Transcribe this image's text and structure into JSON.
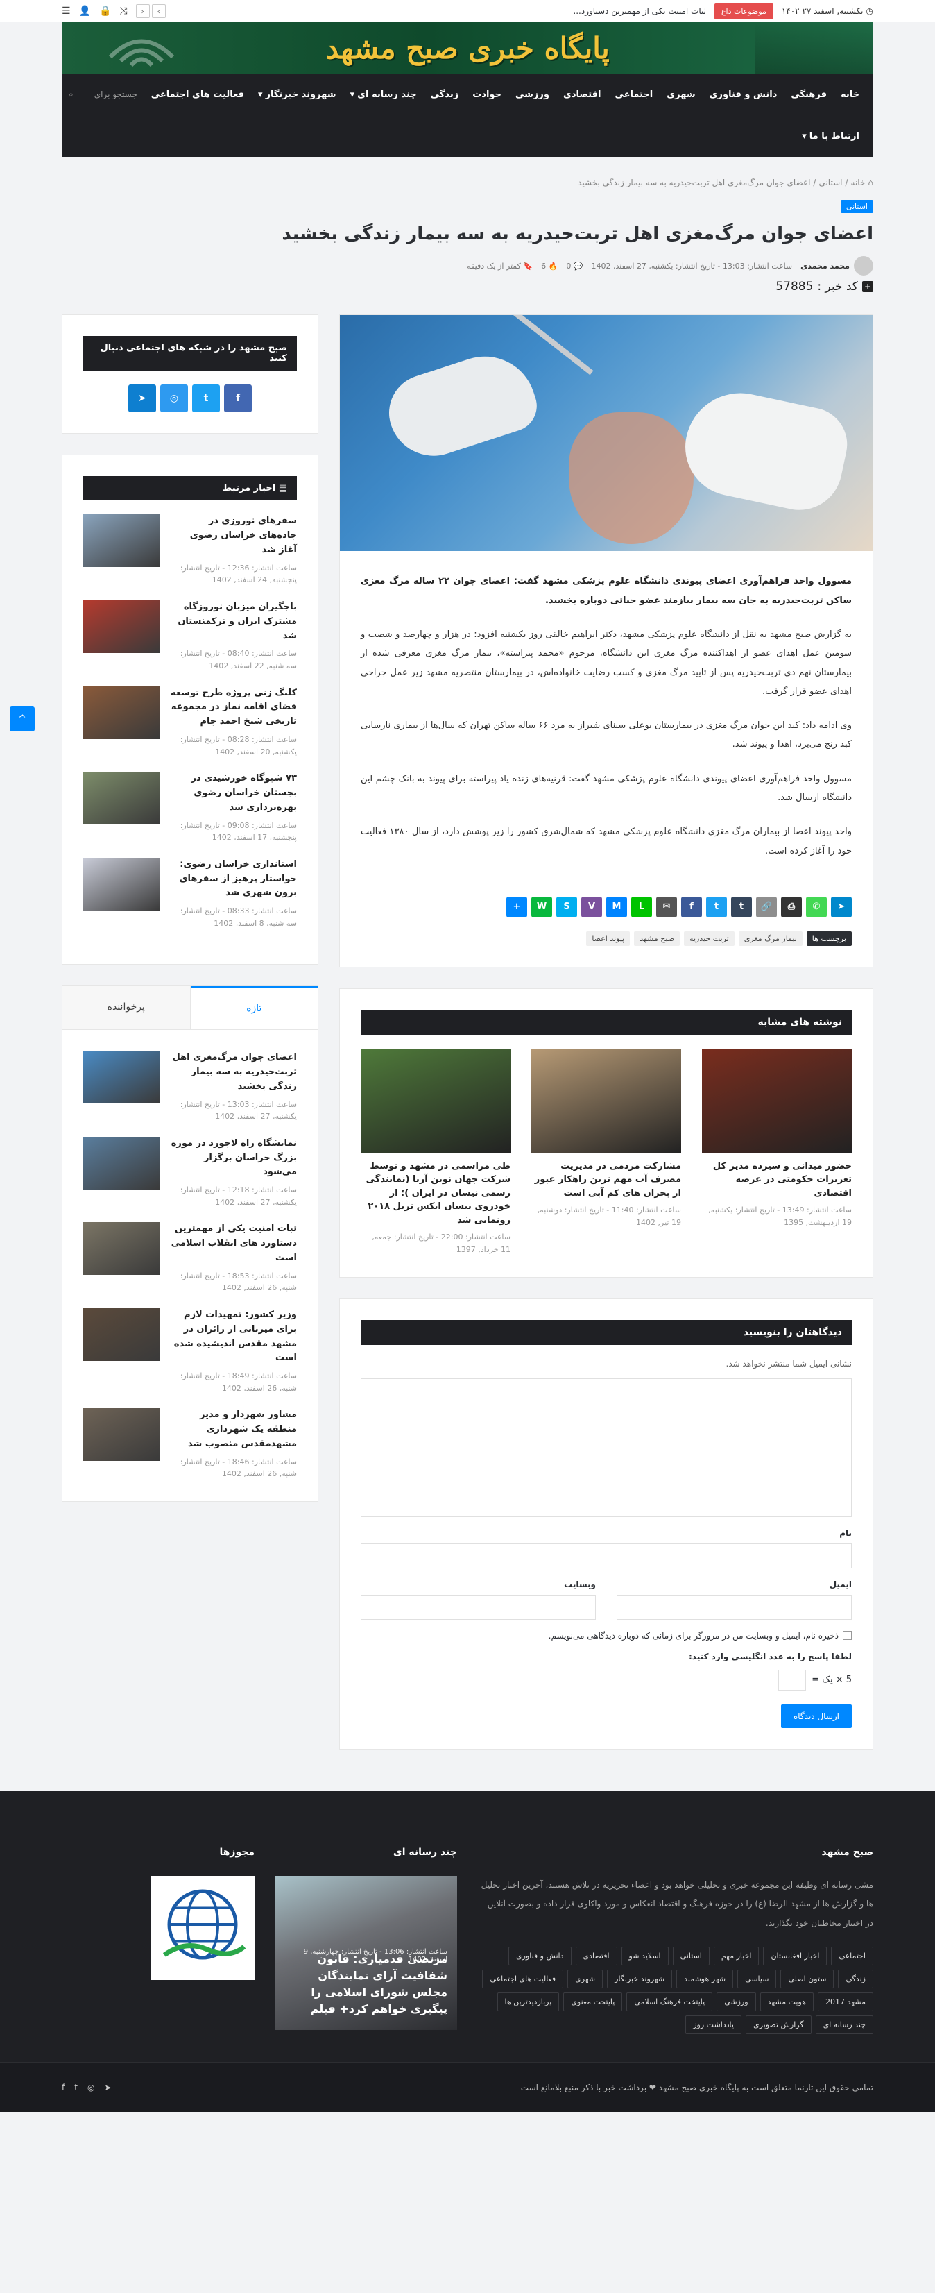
{
  "topbar": {
    "date": "یکشنبه, اسفند ۲۷ ۱۴۰۲",
    "hot_label": "موضوعات داغ",
    "ticker": "ثبات امنیت یکی از مهمترین دستاورد..."
  },
  "banner": {
    "title": "پایگاه خبری صبح مشهد",
    "logo_text": "صبح"
  },
  "nav": {
    "items": [
      {
        "label": "خانه",
        "has_dropdown": false
      },
      {
        "label": "فرهنگی",
        "has_dropdown": false
      },
      {
        "label": "دانش و فناوری",
        "has_dropdown": false
      },
      {
        "label": "شهری",
        "has_dropdown": false
      },
      {
        "label": "اجتماعی",
        "has_dropdown": false
      },
      {
        "label": "اقتصادی",
        "has_dropdown": false
      },
      {
        "label": "ورزشی",
        "has_dropdown": false
      },
      {
        "label": "حوادث",
        "has_dropdown": false
      },
      {
        "label": "زندگی",
        "has_dropdown": false
      },
      {
        "label": "چند رسانه ای",
        "has_dropdown": true
      },
      {
        "label": "شهروند خبرنگار",
        "has_dropdown": true
      },
      {
        "label": "فعالیت های اجتماعی",
        "has_dropdown": false
      }
    ],
    "row2": {
      "label": "ارتباط با ما",
      "has_dropdown": true
    },
    "search_placeholder": "جستجو برای"
  },
  "breadcrumb": {
    "home": "خانه",
    "sep": "/",
    "cat": "استانی",
    "current": "اعضای جوان مرگ‌مغزی اهل تربت‌حیدریه به سه بیمار زندگی بخشید"
  },
  "post": {
    "category": "استانی",
    "title": "اعضای جوان مرگ‌مغزی اهل تربت‌حیدریه به سه بیمار زندگی بخشید",
    "author": "محمد محمدی",
    "meta_time": "ساعت انتشار: 13:03 - تاریخ انتشار: یکشنبه, 27 اسفند, 1402",
    "comments": "0",
    "views": "6",
    "read_time": "کمتر از یک دقیقه",
    "news_code_label": "کد خبر :",
    "news_code": "57885",
    "paragraphs": [
      "مسوول واحد فراهم‌آوری اعضای پیوندی دانشگاه علوم پزشکی مشهد گفت: اعضای جوان ۲۲ ساله مرگ مغزی ساکن تربت‌حیدریه به جان سه بیمار نیازمند عضو حیاتی دوباره بخشید.",
      "به گزارش صبح مشهد به نقل از دانشگاه علوم پزشکی مشهد، دکتر ابراهیم خالقی روز یکشنبه افزود: در هزار و چهارصد و شصت و سومین عمل اهدای عضو از اهداکننده مرگ مغزی این دانشگاه، مرحوم «محمد پیراسته»، بیمار مرگ مغزی معرفی شده از بیمارستان نهم دی تربت‌حیدریه پس از تایید مرگ مغزی و کسب رضایت خانواده‌اش، در بیمارستان منتصریه مشهد زیر عمل جراحی اهدای عضو قرار گرفت.",
      "وی ادامه داد: کبد این جوان مرگ مغزی در بیمارستان بوعلی سینای شیراز به مرد ۶۶ ساله ساکن تهران که سال‌ها از بیماری نارسایی کبد رنج می‌برد، اهدا و پیوند شد.",
      "مسوول واحد فراهم‌آوری اعضای پیوندی دانشگاه علوم پزشکی مشهد گفت: قرنیه‌های زنده یاد پیراسته برای پیوند به بانک چشم این دانشگاه ارسال شد.",
      "واحد پیوند اعضا از بیماران مرگ مغزی دانشگاه علوم پزشکی مشهد که شمال‌شرق کشور را زیر پوشش دارد، از سال ۱۳۸۰ فعالیت خود را آغاز کرده است."
    ],
    "tags_label": "برچسب ها",
    "tags": [
      "بیمار مرگ مغزی",
      "تربت حیدریه",
      "صبح مشهد",
      "پیوند اعضا"
    ]
  },
  "share": [
    {
      "icon": "telegram-icon",
      "glyph": "➤",
      "color": "#08c"
    },
    {
      "icon": "whatsapp-icon",
      "glyph": "✆",
      "color": "#43d854"
    },
    {
      "icon": "print-icon",
      "glyph": "⎙",
      "color": "#333"
    },
    {
      "icon": "link-icon",
      "glyph": "🔗",
      "color": "#8e8e8e"
    },
    {
      "icon": "tumblr-icon",
      "glyph": "t",
      "color": "#35465c"
    },
    {
      "icon": "twitter-icon",
      "glyph": "t",
      "color": "#1da1f2"
    },
    {
      "icon": "facebook-icon",
      "glyph": "f",
      "color": "#3b5998"
    },
    {
      "icon": "email-icon",
      "glyph": "✉",
      "color": "#555"
    },
    {
      "icon": "line-icon",
      "glyph": "L",
      "color": "#00c300"
    },
    {
      "icon": "messenger-icon",
      "glyph": "M",
      "color": "#0084ff"
    },
    {
      "icon": "viber-icon",
      "glyph": "V",
      "color": "#7b519d"
    },
    {
      "icon": "skype-icon",
      "glyph": "S",
      "color": "#00aff0"
    },
    {
      "icon": "wechat-icon",
      "glyph": "W",
      "color": "#09b83e"
    },
    {
      "icon": "share-plus-icon",
      "glyph": "+",
      "color": "#0088ff"
    }
  ],
  "related": {
    "title": "نوشته های مشابه",
    "items": [
      {
        "title": "حضور میدانی و سیزده مدیر کل تعزیرات حکومتی در عرصه اقتصادی",
        "meta": "ساعت انتشار: 13:49 - تاریخ انتشار: یکشنبه, 19 اردیبهشت, 1395",
        "color": "#7a2d1e"
      },
      {
        "title": "مشارکت مردمی در مدیریت مصرف آب مهم ترین راهکار عبور از بحران های کم آبی است",
        "meta": "ساعت انتشار: 11:40 - تاریخ انتشار: دوشنبه, 19 تیر, 1402",
        "color": "#b79a75"
      },
      {
        "title": "طی مراسمی در مشهد و توسط شرکت جهان نوین آریا (نمایندگی رسمی نیسان در ایران )؛ از خودروی نیسان ایکس تریل ۲۰۱۸ رونمایی شد",
        "meta": "ساعت انتشار: 22:00 - تاریخ انتشار: جمعه, 11 خرداد, 1397",
        "color": "#4f7a3a"
      }
    ]
  },
  "comments_form": {
    "title": "دیدگاهتان را بنویسید",
    "note": "نشانی ایمیل شما منتشر نخواهد شد.",
    "name_label": "نام",
    "email_label": "ایمیل",
    "website_label": "وبسایت",
    "save_label": "ذخیره نام، ایمیل و وبسایت من در مرورگر برای زمانی که دوباره دیدگاهی می‌نویسم.",
    "captcha_label": "لطفا پاسخ را به عدد انگلیسی وارد کنید:",
    "captcha_question": "5 × یک =",
    "submit_label": "ارسال دیدگاه"
  },
  "sidebar": {
    "social_title": "صبح مشهد را در شبکه های اجتماعی دنبال کنید",
    "social": [
      {
        "icon": "facebook-icon",
        "glyph": "f",
        "color": "#4267b2"
      },
      {
        "icon": "twitter-icon",
        "glyph": "t",
        "color": "#1da1f2"
      },
      {
        "icon": "instagram-icon",
        "glyph": "◎",
        "color": "#2e9af0"
      },
      {
        "icon": "telegram-icon",
        "glyph": "➤",
        "color": "#0e7fd0"
      }
    ],
    "related_title": "اخبار مرتبط",
    "related_posts": [
      {
        "title": "سفرهای نوروزی در جاده‌های خراسان رضوی آغاز شد",
        "meta": "ساعت انتشار: 12:36 - تاریخ انتشار: پنجشنبه, 24 اسفند, 1402",
        "color": "#8aa4bd"
      },
      {
        "title": "باجگیران میزبان نوروزگاه مشترک ایران و ترکمنستان شد",
        "meta": "ساعت انتشار: 08:40 - تاریخ انتشار: سه شنبه, 22 اسفند, 1402",
        "color": "#b53a2e"
      },
      {
        "title": "کلنگ زنی پروژه طرح توسعه فضای اقامه نماز در مجموعه تاریخی شیخ احمد جام",
        "meta": "ساعت انتشار: 08:28 - تاریخ انتشار: یکشنبه, 20 اسفند, 1402",
        "color": "#8a5a3a"
      },
      {
        "title": "۷۳ شبوگاه خورشیدی در بجستان خراسان رضوی بهره‌برداری شد",
        "meta": "ساعت انتشار: 09:08 - تاریخ انتشار: پنجشنبه, 17 اسفند, 1402",
        "color": "#7d8d6a"
      },
      {
        "title": "استانداری خراسان رضوی: خواستار پرهیز از سفرهای برون شهری شد",
        "meta": "ساعت انتشار: 08:33 - تاریخ انتشار: سه شنبه, 8 اسفند, 1402",
        "color": "#c9ccd8"
      }
    ],
    "tab_latest": "تازه",
    "tab_popular": "پرخواننده",
    "latest_posts": [
      {
        "title": "اعضای جوان مرگ‌مغزی اهل تربت‌حیدریه به سه بیمار زندگی بخشید",
        "meta": "ساعت انتشار: 13:03 - تاریخ انتشار: یکشنبه, 27 اسفند, 1402",
        "color": "#4a8bc4"
      },
      {
        "title": "نمایشگاه راه لاجورد در موزه بزرگ خراسان برگزار می‌شود",
        "meta": "ساعت انتشار: 12:18 - تاریخ انتشار: یکشنبه, 27 اسفند, 1402",
        "color": "#5a7e9e"
      },
      {
        "title": "ثبات امنیت یکی از مهمترین دستاورد های انقلاب اسلامی است",
        "meta": "ساعت انتشار: 18:53 - تاریخ انتشار: شنبه, 26 اسفند, 1402",
        "color": "#7b7565"
      },
      {
        "title": "وزیر کشور: تمهیدات لازم برای میزبانی از زائران در مشهد مقدس اندیشیده شده است",
        "meta": "ساعت انتشار: 18:49 - تاریخ انتشار: شنبه, 26 اسفند, 1402",
        "color": "#5b4a3b"
      },
      {
        "title": "مشاور شهردار و مدیر منطقه یک شهرداری مشهدمقدس منصوب شد",
        "meta": "ساعت انتشار: 18:46 - تاریخ انتشار: شنبه, 26 اسفند, 1402",
        "color": "#6e6356"
      }
    ]
  },
  "footer": {
    "about_title": "صبح مشهد",
    "about_text": "مشی رسانه ای وظیفه این مجموعه خبری و تحلیلی خواهد بود و اعضاء تحریریه در تلاش هستند، آخرین اخبار تحلیل ها و گزارش ها از مشهد الرضا (ع) را در حوزه فرهنگ و اقتصاد انعکاس و مورد واکاوی قرار داده و بصورت آنلاین در اختیار مخاطبان خود بگذارند.",
    "tags": [
      "اجتماعی",
      "اخبار افغانستان",
      "اخبار مهم",
      "استانی",
      "اسلاید شو",
      "اقتصادی",
      "دانش و فناوری",
      "زندگی",
      "ستون اصلی",
      "سیاسی",
      "شهر هوشمند",
      "شهروند خبرنگار",
      "شهری",
      "فعالیت های اجتماعی",
      "مشهد 2017",
      "هویت مشهد",
      "ورزشی",
      "پایتخت فرهنگ اسلامی",
      "پایتخت معنوی",
      "پربازدیدترین ها",
      "چند رسانه ای",
      "گزارش تصویری",
      "یادداشت روز"
    ],
    "media_title": "چند رسانه ای",
    "media_meta": "ساعت انتشار: 13:06 - تاریخ انتشار: چهارشنبه, 9 اسفند, 1402",
    "media_caption": "مرتضی قدمیاری: قانون شفافیت آرای نمایندگان مجلس شورای اسلامی را پیگیری خواهم کرد+ فیلم",
    "licenses_title": "مجوزها",
    "copyright": "تمامی حقوق این تارنما متعلق است به پایگاه خبری صبح مشهد ❤ برداشت خبر با ذکر منبع بلامانع است"
  }
}
